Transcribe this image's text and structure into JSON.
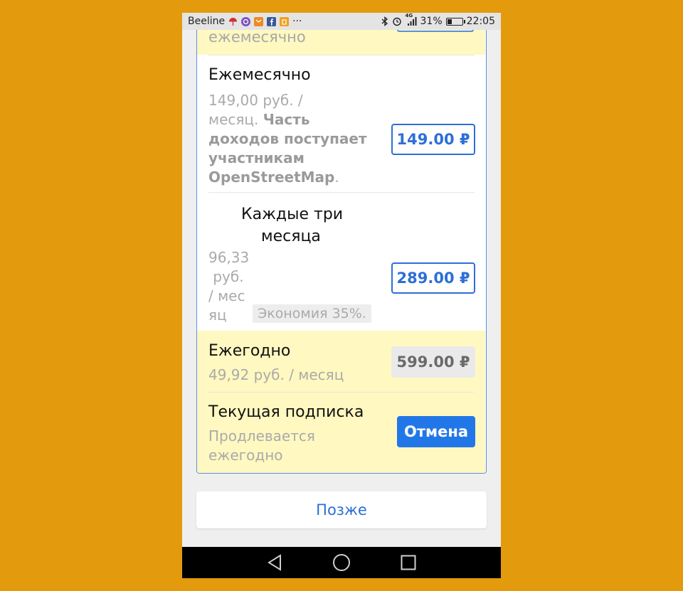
{
  "status_bar": {
    "carrier": "Beeline",
    "more": "···",
    "network": "4G",
    "battery": "31%",
    "battery_level": 0.31,
    "time": "22:05"
  },
  "plans": {
    "top_partial_text": "ежемесячно",
    "monthly": {
      "title": "Ежемесячно",
      "sub_line1": "149,00 руб. /",
      "sub_line2_prefix": "месяц. ",
      "sub_bold": "Часть",
      "sub_bold_lines": [
        "доходов поступает",
        "участникам",
        "OpenStreetMap"
      ],
      "sub_suffix": ".",
      "price": "149.00 ₽"
    },
    "quarterly": {
      "title_line1": "Каждые три",
      "title_line2": "месяца",
      "sub_lines": [
        "96,33",
        " руб.",
        "/ мес",
        "яц"
      ],
      "savings": "Экономия 35%.",
      "price": "289.00 ₽"
    },
    "yearly": {
      "title": "Ежегодно",
      "sub": "49,92 руб. / месяц",
      "price": "599.00 ₽"
    },
    "current": {
      "title": "Текущая подписка",
      "sub_line1": "Продлевается",
      "sub_line2": "ежегодно",
      "cancel_label": "Отмена"
    }
  },
  "later_label": "Позже",
  "colors": {
    "background": "#E39A0C",
    "accent_blue": "#2D6FD6",
    "highlight_yellow": "#FFF8C0",
    "cancel_blue": "#2277E8"
  },
  "icons": [
    "umbrella-icon",
    "viber-icon",
    "mail-icon",
    "facebook-icon",
    "notification-icon",
    "bluetooth-icon",
    "alarm-icon",
    "signal-icon",
    "battery-icon",
    "back-icon",
    "home-icon",
    "recents-icon"
  ]
}
